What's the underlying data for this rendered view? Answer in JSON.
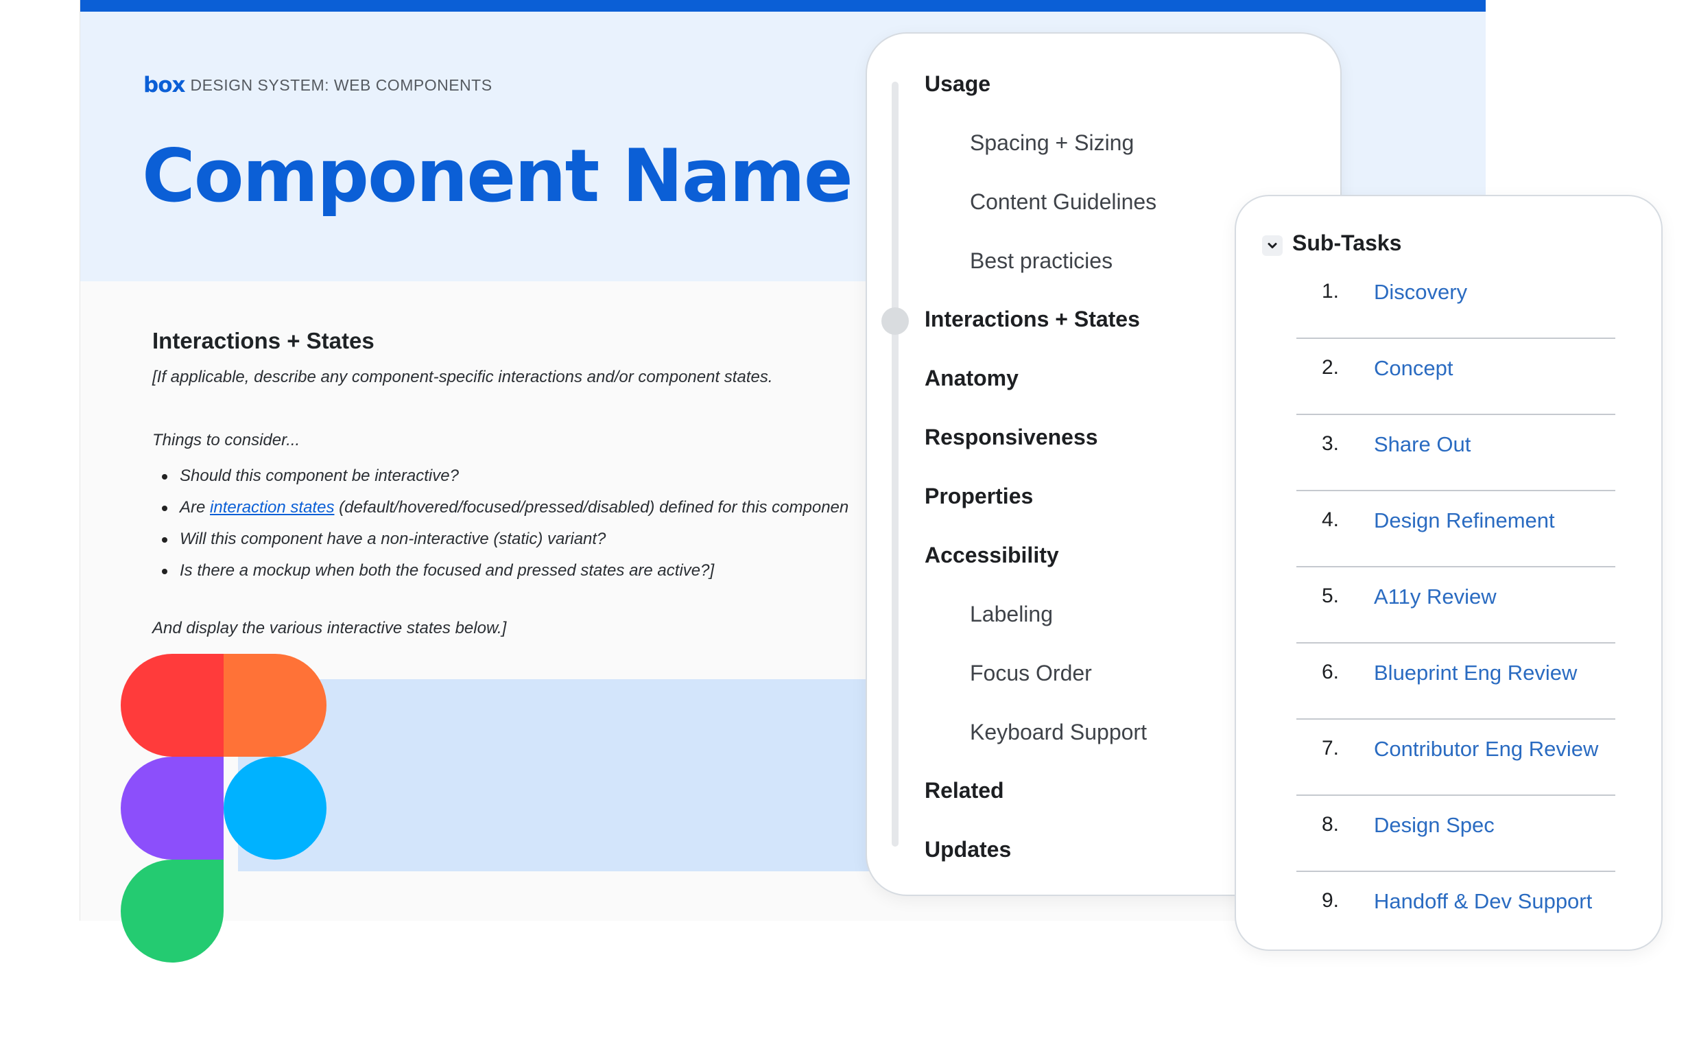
{
  "brand": {
    "logo": "box",
    "label": "DESIGN SYSTEM: WEB COMPONENTS"
  },
  "doc": {
    "title": "Component Name",
    "section_heading": "Interactions + States",
    "description": "[If applicable, describe any component-specific interactions and/or component states.",
    "things_label": "Things to consider...",
    "bullets": {
      "b1": "Should this component be interactive?",
      "b2_pre": "Are ",
      "b2_link": "interaction states",
      "b2_post": " (default/hovered/focused/pressed/disabled) defined for this componen",
      "b3": "Will this component have a non-interactive (static) variant?",
      "b4": "Is there a mockup when both the focused and pressed states are active?]"
    },
    "closing": "And display the various interactive states below.]"
  },
  "toc": {
    "items": [
      {
        "label": "Usage",
        "level": "major"
      },
      {
        "label": "Spacing + Sizing",
        "level": "minor"
      },
      {
        "label": "Content Guidelines",
        "level": "minor"
      },
      {
        "label": "Best practicies",
        "level": "minor"
      },
      {
        "label": "Interactions + States",
        "level": "major",
        "active": true
      },
      {
        "label": "Anatomy",
        "level": "major"
      },
      {
        "label": "Responsiveness",
        "level": "major"
      },
      {
        "label": "Properties",
        "level": "major"
      },
      {
        "label": "Accessibility",
        "level": "major"
      },
      {
        "label": "Labeling",
        "level": "minor"
      },
      {
        "label": "Focus Order",
        "level": "minor"
      },
      {
        "label": "Keyboard Support",
        "level": "minor"
      },
      {
        "label": "Related",
        "level": "major"
      },
      {
        "label": "Updates",
        "level": "major"
      }
    ]
  },
  "subtasks": {
    "title": "Sub-Tasks",
    "toggle_icon": "chevron-down-icon",
    "items": [
      {
        "num": "1.",
        "label": "Discovery"
      },
      {
        "num": "2.",
        "label": "Concept"
      },
      {
        "num": "3.",
        "label": "Share Out"
      },
      {
        "num": "4.",
        "label": "Design Refinement"
      },
      {
        "num": "5.",
        "label": "A11y Review"
      },
      {
        "num": "6.",
        "label": "Blueprint Eng Review"
      },
      {
        "num": "7.",
        "label": "Contributor Eng Review"
      },
      {
        "num": "8.",
        "label": "Design Spec"
      },
      {
        "num": "9.",
        "label": "Handoff & Dev Support"
      }
    ]
  },
  "colors": {
    "brand_blue": "#0b5fd6",
    "link_blue": "#2a6bc1",
    "figma_red": "#f24e1e",
    "figma_orange": "#ff7262",
    "figma_purple": "#a259ff",
    "figma_blue": "#1abcfe",
    "figma_green": "#0acf83"
  },
  "figma_logo": "figma-logo-icon"
}
